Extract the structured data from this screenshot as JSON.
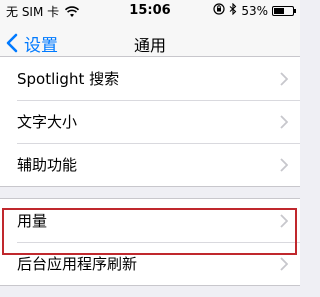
{
  "status_bar": {
    "carrier": "无 SIM 卡",
    "time": "15:06",
    "battery_percent": "53%",
    "battery_level": 0.53,
    "icons": [
      "wifi-icon",
      "rotation-lock-icon",
      "bluetooth-icon",
      "battery-icon"
    ]
  },
  "nav": {
    "back_label": "设置",
    "title": "通用"
  },
  "group_1": {
    "items": [
      {
        "label": "Spotlight 搜索"
      },
      {
        "label": "文字大小"
      },
      {
        "label": "辅助功能"
      }
    ]
  },
  "group_2": {
    "items": [
      {
        "label": "用量"
      },
      {
        "label": "后台应用程序刷新"
      }
    ]
  },
  "colors": {
    "accent": "#007aff",
    "highlight": "#c0282d",
    "background": "#efeff4"
  }
}
